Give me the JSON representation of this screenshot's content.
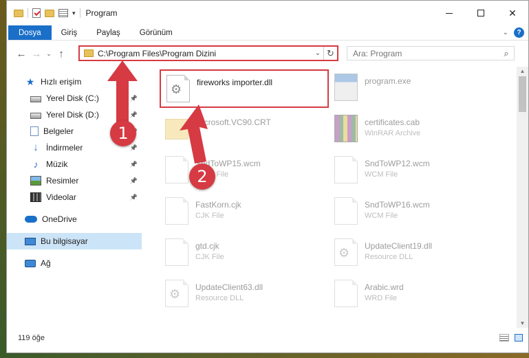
{
  "window": {
    "title": "Program"
  },
  "ribbon": {
    "tabs": [
      "Dosya",
      "Giriş",
      "Paylaş",
      "Görünüm"
    ],
    "help": "?"
  },
  "nav": {
    "address": "C:\\Program Files\\Program Dizini",
    "search_placeholder": "Ara: Program"
  },
  "sidebar": {
    "items": [
      {
        "label": "Hızlı erişim",
        "icon": "star-icon",
        "pinned": false
      },
      {
        "label": "Yerel Disk (C:)",
        "icon": "drive-icon",
        "pinned": true
      },
      {
        "label": "Yerel Disk (D:)",
        "icon": "drive-icon",
        "pinned": true
      },
      {
        "label": "Belgeler",
        "icon": "documents-icon",
        "pinned": true
      },
      {
        "label": "İndirmeler",
        "icon": "download-icon",
        "pinned": true
      },
      {
        "label": "Müzik",
        "icon": "music-icon",
        "pinned": true
      },
      {
        "label": "Resimler",
        "icon": "pictures-icon",
        "pinned": true
      },
      {
        "label": "Videolar",
        "icon": "video-icon",
        "pinned": true
      },
      {
        "label": "OneDrive",
        "icon": "cloud-icon",
        "pinned": false
      },
      {
        "label": "Bu bilgisayar",
        "icon": "computer-icon",
        "pinned": false
      },
      {
        "label": "Ağ",
        "icon": "network-icon",
        "pinned": false
      }
    ]
  },
  "files": [
    {
      "name": "fireworks importer.dll",
      "type": "",
      "icon": "dll-gear-icon"
    },
    {
      "name": "program.exe",
      "type": "",
      "icon": "exe-icon"
    },
    {
      "name": "Microsoft.VC90.CRT",
      "type": "",
      "icon": "folder-icon"
    },
    {
      "name": "certificates.cab",
      "type": "WinRAR Archive",
      "icon": "winrar-icon"
    },
    {
      "name": "SndToWP15.wcm",
      "type": "WCM File",
      "icon": "blank-file-icon"
    },
    {
      "name": "SndToWP12.wcm",
      "type": "WCM File",
      "icon": "blank-file-icon"
    },
    {
      "name": "FastKorn.cjk",
      "type": "CJK File",
      "icon": "blank-file-icon"
    },
    {
      "name": "SndToWP16.wcm",
      "type": "WCM File",
      "icon": "blank-file-icon"
    },
    {
      "name": "gtd.cjk",
      "type": "CJK File",
      "icon": "blank-file-icon"
    },
    {
      "name": "UpdateClient19.dll",
      "type": "Resource DLL",
      "icon": "dll-gear-icon"
    },
    {
      "name": "UpdateClient63.dll",
      "type": "Resource DLL",
      "icon": "dll-gear-icon"
    },
    {
      "name": "Arabic.wrd",
      "type": "WRD File",
      "icon": "blank-file-icon"
    }
  ],
  "status": {
    "count": "119 öğe"
  },
  "annotations": {
    "step1": "1",
    "step2": "2"
  },
  "colors": {
    "accent": "#1a6fc8",
    "highlight_red": "#d63a43",
    "selection": "#cce4f7"
  }
}
